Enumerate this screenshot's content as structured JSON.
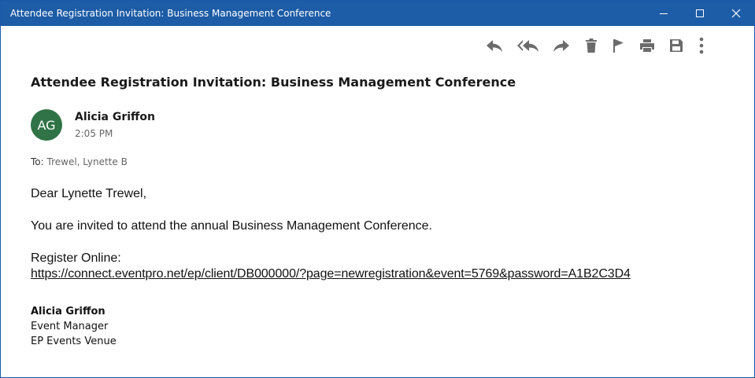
{
  "window": {
    "title": "Attendee Registration Invitation: Business Management Conference",
    "controls": [
      "minimize-icon",
      "maximize-icon",
      "close-icon"
    ]
  },
  "toolbar": {
    "icons": [
      "reply-icon",
      "reply-all-icon",
      "forward-icon",
      "delete-icon",
      "flag-icon",
      "print-icon",
      "save-icon",
      "more-options-icon"
    ]
  },
  "email": {
    "subject": "Attendee Registration Invitation: Business Management Conference",
    "sender": {
      "initials": "AG",
      "name": "Alicia Griffon",
      "time": "2:05 PM",
      "avatar_color": "#2f7346"
    },
    "to_label": "To:",
    "to_value": "Trewel, Lynette B",
    "greeting": "Dear Lynette Trewel,",
    "invite_text": "You are invited to attend the annual Business Management Conference.",
    "register_label": "Register Online:",
    "register_link": "https://connect.eventpro.net/ep/client/DB000000/?page=newregistration&event=5769&password=A1B2C3D4",
    "signature": {
      "name": "Alicia Griffon",
      "role": "Event Manager",
      "venue": "EP Events Venue"
    }
  },
  "colors": {
    "titlebar": "#1d5ca6",
    "icon_gray": "#6b6b6b"
  }
}
